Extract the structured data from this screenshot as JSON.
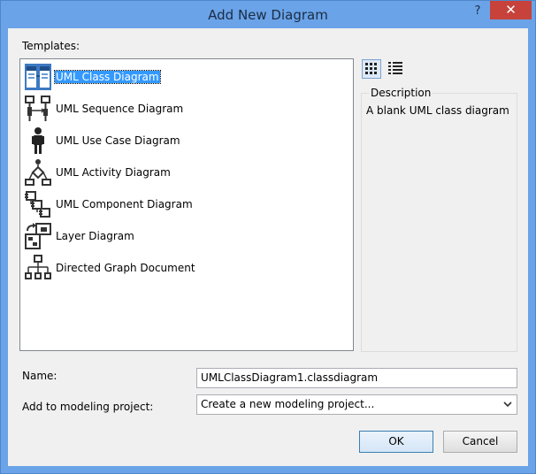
{
  "window": {
    "title": "Add New Diagram",
    "help_glyph": "?",
    "close_glyph": "✕"
  },
  "templates": {
    "label": "Templates:",
    "items": [
      {
        "label": "UML Class Diagram",
        "icon": "uml-class-diagram-icon",
        "selected": true
      },
      {
        "label": "UML Sequence Diagram",
        "icon": "uml-sequence-diagram-icon"
      },
      {
        "label": "UML Use Case Diagram",
        "icon": "uml-use-case-diagram-icon"
      },
      {
        "label": "UML Activity Diagram",
        "icon": "uml-activity-diagram-icon"
      },
      {
        "label": "UML Component Diagram",
        "icon": "uml-component-diagram-icon"
      },
      {
        "label": "Layer Diagram",
        "icon": "layer-diagram-icon"
      },
      {
        "label": "Directed Graph Document",
        "icon": "directed-graph-icon"
      }
    ]
  },
  "view_toggle": {
    "active": "small-icons-view",
    "icons": [
      "small-icons-view-icon",
      "list-view-icon"
    ]
  },
  "description": {
    "title": "Description",
    "text": "A blank UML class diagram"
  },
  "form": {
    "name_label": "Name:",
    "name_value": "UMLClassDiagram1.classdiagram",
    "project_label": "Add to modeling project:",
    "project_value": "Create a new modeling project..."
  },
  "buttons": {
    "ok": "OK",
    "cancel": "Cancel"
  },
  "colors": {
    "titlebar": "#6aa3e8",
    "close": "#c7423a",
    "selection": "#3399ff"
  }
}
